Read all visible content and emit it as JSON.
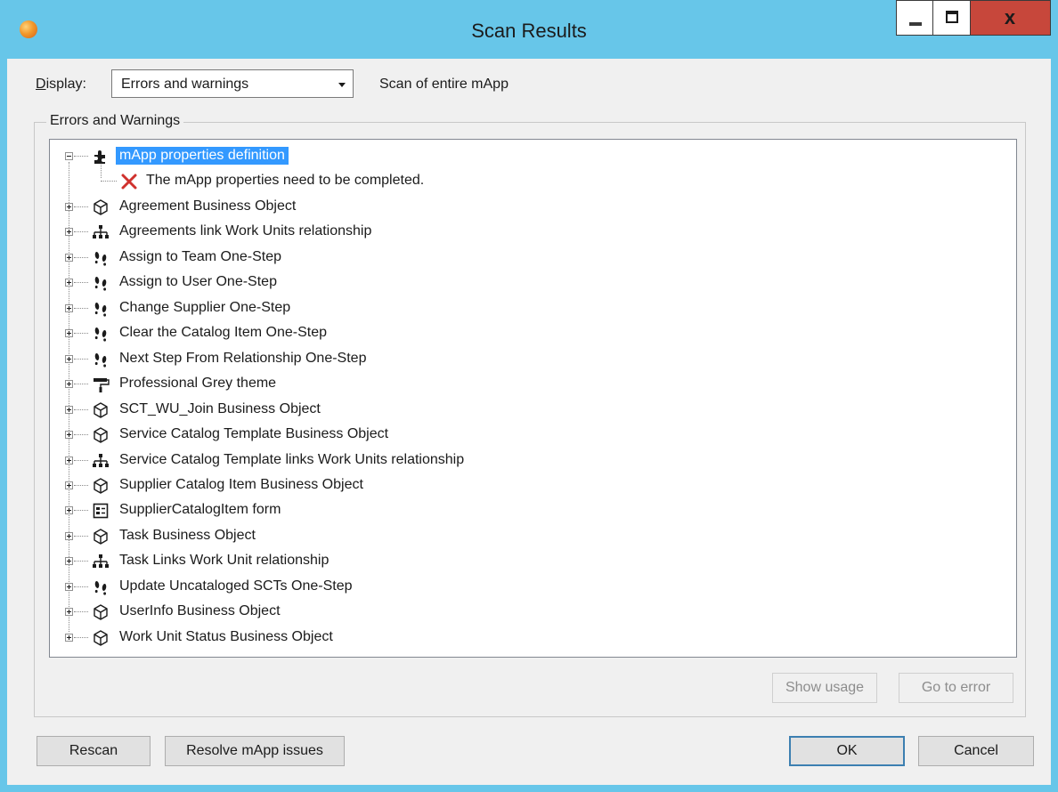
{
  "window": {
    "title": "Scan Results",
    "close_glyph": "x"
  },
  "display": {
    "label_accel": "D",
    "label_rest": "isplay:",
    "selected": "Errors and warnings",
    "scope_text": "Scan of entire mApp"
  },
  "group": {
    "caption": "Errors and Warnings"
  },
  "tree": {
    "root": {
      "label": "mApp properties definition",
      "icon": "puzzle-icon"
    },
    "child": {
      "label": "The mApp properties need to be completed.",
      "icon": "error-x-icon"
    },
    "items": [
      {
        "label": "Agreement Business Object",
        "icon": "cube-icon"
      },
      {
        "label": "Agreements link Work Units relationship",
        "icon": "hierarchy-icon"
      },
      {
        "label": "Assign to Team One-Step",
        "icon": "footsteps-icon"
      },
      {
        "label": "Assign to User One-Step",
        "icon": "footsteps-icon"
      },
      {
        "label": "Change Supplier One-Step",
        "icon": "footsteps-icon"
      },
      {
        "label": "Clear the Catalog Item One-Step",
        "icon": "footsteps-icon"
      },
      {
        "label": "Next Step From Relationship One-Step",
        "icon": "footsteps-icon"
      },
      {
        "label": "Professional Grey theme",
        "icon": "paint-roller-icon"
      },
      {
        "label": "SCT_WU_Join Business Object",
        "icon": "cube-icon"
      },
      {
        "label": "Service Catalog Template Business Object",
        "icon": "cube-icon"
      },
      {
        "label": "Service Catalog Template links Work Units relationship",
        "icon": "hierarchy-icon"
      },
      {
        "label": "Supplier Catalog Item Business Object",
        "icon": "cube-icon"
      },
      {
        "label": "SupplierCatalogItem form",
        "icon": "form-icon"
      },
      {
        "label": "Task Business Object",
        "icon": "cube-icon"
      },
      {
        "label": "Task Links Work Unit relationship",
        "icon": "hierarchy-icon"
      },
      {
        "label": "Update Uncataloged SCTs One-Step",
        "icon": "footsteps-icon"
      },
      {
        "label": "UserInfo Business Object",
        "icon": "cube-icon"
      },
      {
        "label": "Work Unit Status Business Object",
        "icon": "cube-icon"
      }
    ]
  },
  "buttons": {
    "show_usage": "Show usage",
    "go_to_error": "Go to error",
    "rescan": "Rescan",
    "resolve": "Resolve mApp issues",
    "ok": "OK",
    "cancel": "Cancel"
  },
  "colors": {
    "title_bar": "#67c6e9",
    "close_button": "#c7473b",
    "selection": "#3399ff",
    "error_red": "#d0312d"
  }
}
